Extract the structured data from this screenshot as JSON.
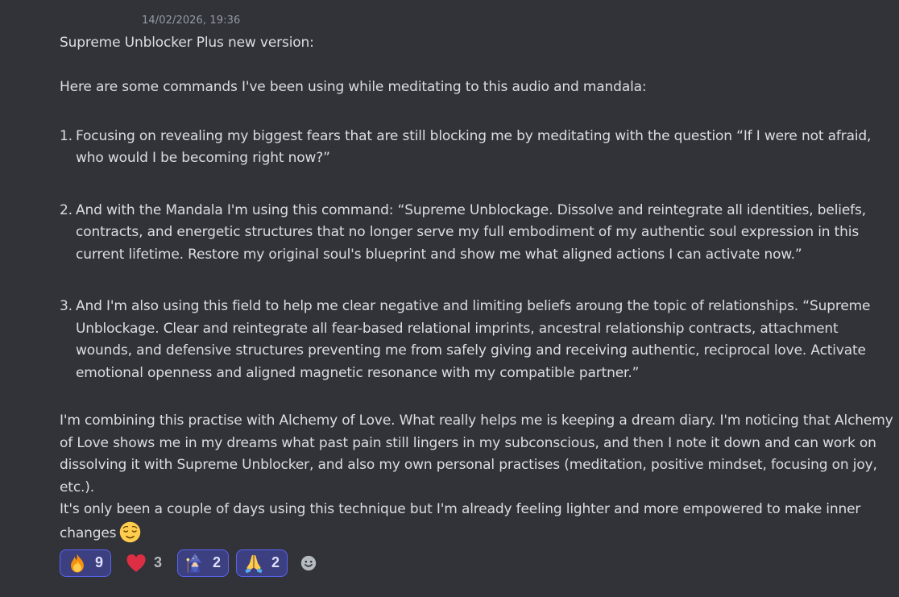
{
  "message": {
    "timestamp": "14/02/2026, 19:36",
    "title_line": "Supreme Unblocker Plus new version:",
    "intro": "Here are some commands I've been using while meditating to this audio and mandala:",
    "list": [
      {
        "number": "1.",
        "text": "Focusing on revealing my biggest fears that are still blocking me by meditating with the question “If I were not afraid, who would I be becoming right now?”"
      },
      {
        "number": "2.",
        "text": "And with the Mandala I'm using this command: “Supreme Unblockage. Dissolve and reintegrate all identities, beliefs, contracts, and energetic structures that no longer serve my full embodiment of my authentic soul expression in this current lifetime. Restore my original soul's blueprint and show me what aligned actions I can activate now.”"
      },
      {
        "number": "3.",
        "text": "And I'm also using this field to help me clear negative  and limiting beliefs aroung the topic of relationships. “Supreme Unblockage. Clear and reintegrate all fear-based relational imprints, ancestral relationship contracts, attachment wounds, and defensive structures preventing me from safely giving and receiving authentic, reciprocal love. Activate emotional openness and aligned magnetic resonance with my compatible partner.”"
      }
    ],
    "closing_1": "I'm combining this practise with Alchemy of Love. What really helps me is keeping a dream diary. I'm noticing that Alchemy of Love shows me in my dreams what past pain still lingers in my subconscious, and then I note it down and can work on dissolving it with Supreme Unblocker, and also my own personal practises (meditation, positive mindset, focusing on joy, etc.).",
    "closing_2": "It's only been a couple of days using this technique but I'm already feeling lighter and more empowered to make inner changes",
    "closing_2_emoji": "relieved-face-emoji"
  },
  "reactions": [
    {
      "emoji": "fire-emoji",
      "count": "9",
      "active": true
    },
    {
      "emoji": "red-heart-emoji",
      "count": "3",
      "active": false
    },
    {
      "emoji": "mage-emoji",
      "count": "2",
      "active": true
    },
    {
      "emoji": "folded-hands-emoji",
      "count": "2",
      "active": true
    }
  ],
  "add_reaction_icon": "smiley-add-reaction-icon",
  "colors": {
    "background": "#313338",
    "text": "#dbdee1",
    "timestamp": "#949ba4",
    "reaction_active_bg": "#3c3f80",
    "reaction_active_border": "#5865f2"
  }
}
